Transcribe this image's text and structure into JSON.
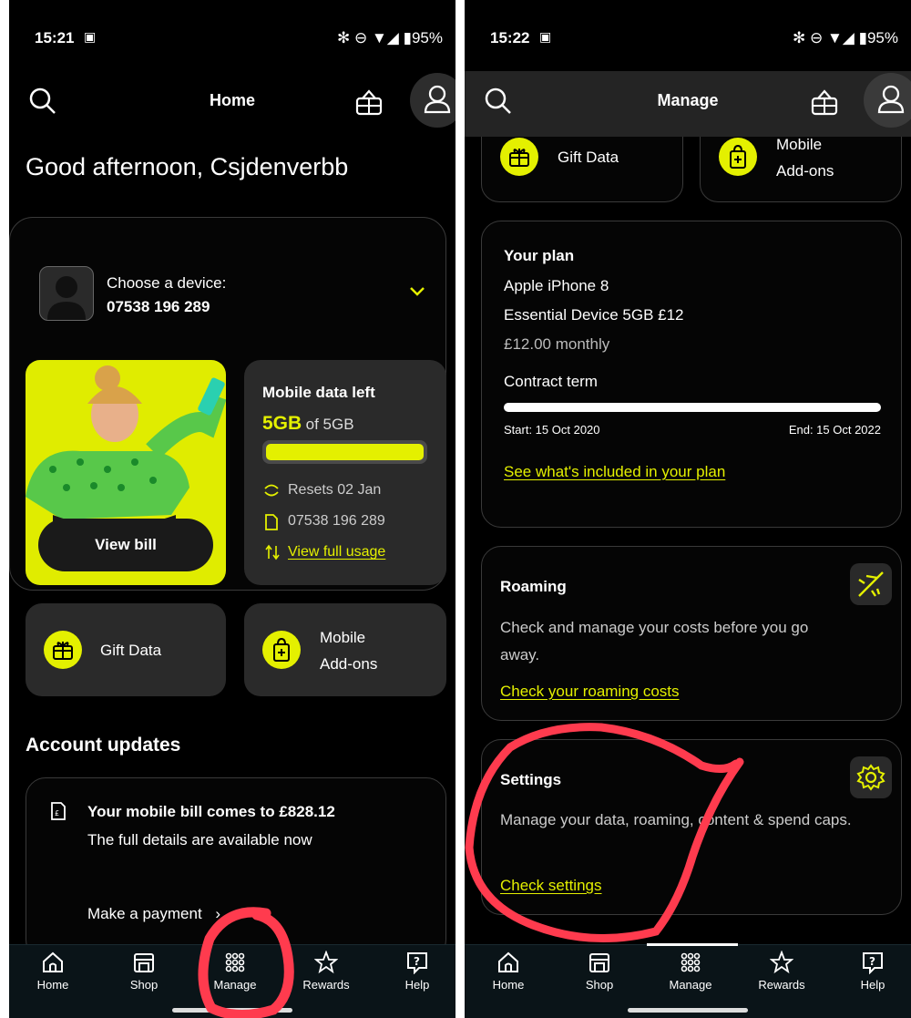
{
  "left": {
    "status": {
      "time": "15:21",
      "battery": "95%"
    },
    "header": {
      "title": "Home"
    },
    "greeting": "Good afternoon, Csjdenverbb",
    "device": {
      "label": "Choose a device:",
      "number": "07538 196 289"
    },
    "view_bill": "View bill",
    "data": {
      "title": "Mobile data left",
      "amount": "5GB",
      "of": "of 5GB",
      "fraction": 1.0,
      "resets": "Resets 02 Jan",
      "number": "07538 196 289",
      "usage_link": "View full usage"
    },
    "gift_data": "Gift Data",
    "addons": {
      "line1": "Mobile",
      "line2": "Add-ons"
    },
    "account_updates": "Account updates",
    "bill": {
      "title": "Your mobile bill comes to £828.12",
      "subtitle": "The full details are available now",
      "payment": "Make a payment"
    }
  },
  "right": {
    "status": {
      "time": "15:22",
      "battery": "95%"
    },
    "header": {
      "title": "Manage"
    },
    "gift_data": "Gift Data",
    "addons": {
      "line1": "Mobile",
      "line2": "Add-ons"
    },
    "plan": {
      "heading": "Your plan",
      "device": "Apple iPhone 8",
      "tariff": "Essential Device 5GB £12",
      "price": "£12.00 monthly",
      "contract": "Contract term",
      "progress": 1.0,
      "start": "Start: 15 Oct 2020",
      "end": "End: 15 Oct 2022",
      "link": "See what's included in your plan"
    },
    "roaming": {
      "heading": "Roaming",
      "desc": "Check and manage your costs before you go away.",
      "link": "Check your roaming costs"
    },
    "settings": {
      "heading": "Settings",
      "desc": "Manage your data, roaming, content & spend caps.",
      "link": "Check settings"
    }
  },
  "nav": [
    {
      "label": "Home",
      "icon": "home-icon"
    },
    {
      "label": "Shop",
      "icon": "shop-icon"
    },
    {
      "label": "Manage",
      "icon": "grid-icon"
    },
    {
      "label": "Rewards",
      "icon": "star-icon"
    },
    {
      "label": "Help",
      "icon": "help-icon"
    }
  ],
  "colors": {
    "accent": "#e4f000",
    "annotation": "#ff3b4e"
  }
}
